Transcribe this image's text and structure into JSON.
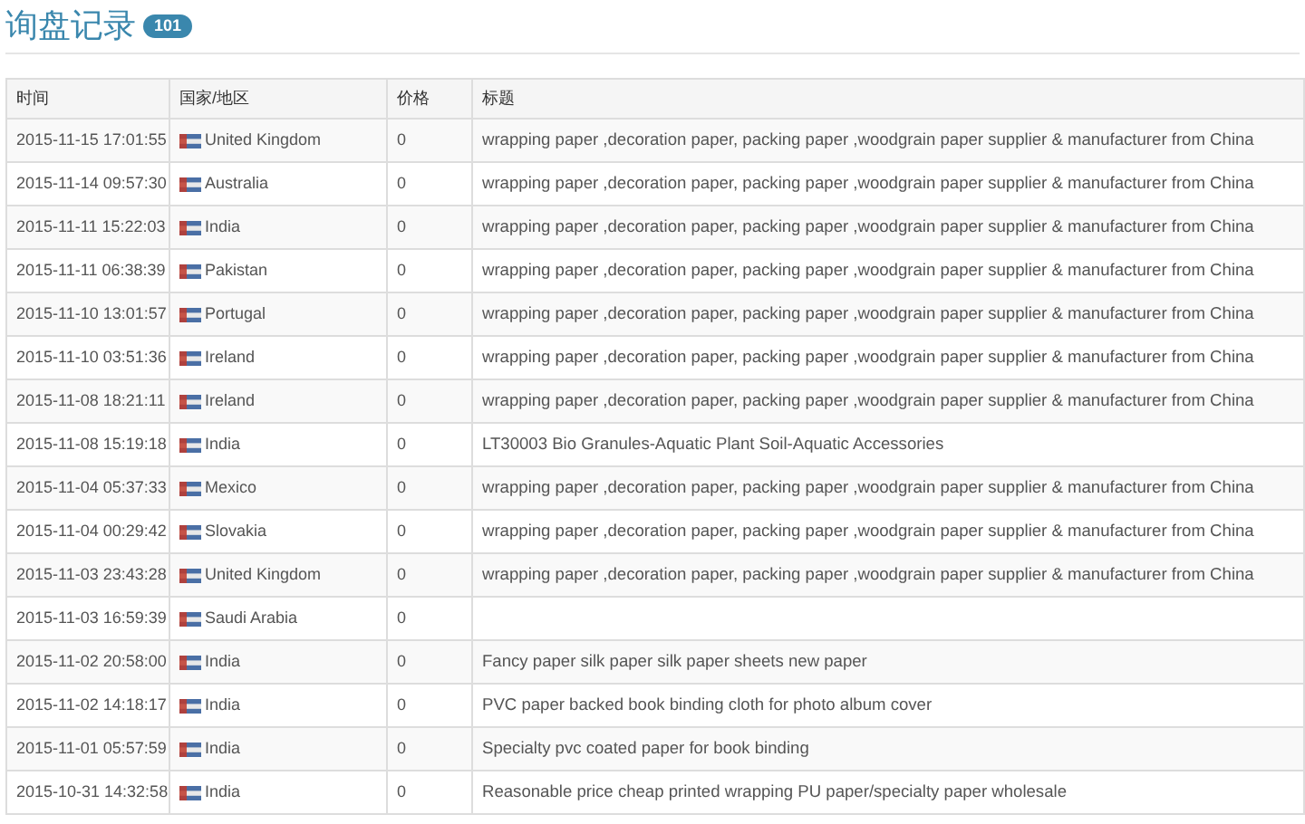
{
  "title": "询盘记录",
  "count": "101",
  "table": {
    "columns": [
      "时间",
      "国家/地区",
      "价格",
      "标题"
    ],
    "rows": [
      {
        "time": "2015-11-15 17:01:55",
        "country": "United Kingdom",
        "price": "0",
        "title": "wrapping paper ,decoration paper, packing paper ,woodgrain paper supplier & manufacturer from China"
      },
      {
        "time": "2015-11-14 09:57:30",
        "country": "Australia",
        "price": "0",
        "title": "wrapping paper ,decoration paper, packing paper ,woodgrain paper supplier & manufacturer from China"
      },
      {
        "time": "2015-11-11 15:22:03",
        "country": "India",
        "price": "0",
        "title": "wrapping paper ,decoration paper, packing paper ,woodgrain paper supplier & manufacturer from China"
      },
      {
        "time": "2015-11-11 06:38:39",
        "country": "Pakistan",
        "price": "0",
        "title": "wrapping paper ,decoration paper, packing paper ,woodgrain paper supplier & manufacturer from China"
      },
      {
        "time": "2015-11-10 13:01:57",
        "country": "Portugal",
        "price": "0",
        "title": "wrapping paper ,decoration paper, packing paper ,woodgrain paper supplier & manufacturer from China"
      },
      {
        "time": "2015-11-10 03:51:36",
        "country": "Ireland",
        "price": "0",
        "title": "wrapping paper ,decoration paper, packing paper ,woodgrain paper supplier & manufacturer from China"
      },
      {
        "time": "2015-11-08 18:21:11",
        "country": "Ireland",
        "price": "0",
        "title": "wrapping paper ,decoration paper, packing paper ,woodgrain paper supplier & manufacturer from China"
      },
      {
        "time": "2015-11-08 15:19:18",
        "country": "India",
        "price": "0",
        "title": "LT30003 Bio Granules-Aquatic Plant Soil-Aquatic Accessories"
      },
      {
        "time": "2015-11-04 05:37:33",
        "country": "Mexico",
        "price": "0",
        "title": "wrapping paper ,decoration paper, packing paper ,woodgrain paper supplier & manufacturer from China"
      },
      {
        "time": "2015-11-04 00:29:42",
        "country": "Slovakia",
        "price": "0",
        "title": "wrapping paper ,decoration paper, packing paper ,woodgrain paper supplier & manufacturer from China"
      },
      {
        "time": "2015-11-03 23:43:28",
        "country": "United Kingdom",
        "price": "0",
        "title": "wrapping paper ,decoration paper, packing paper ,woodgrain paper supplier & manufacturer from China"
      },
      {
        "time": "2015-11-03 16:59:39",
        "country": "Saudi Arabia",
        "price": "0"
      },
      {
        "time": "2015-11-02 20:58:00",
        "country": "India",
        "price": "0",
        "title": "Fancy paper silk paper silk paper sheets new paper"
      },
      {
        "time": "2015-11-02 14:18:17",
        "country": "India",
        "price": "0",
        "title": "PVC paper backed book binding cloth for photo album cover"
      },
      {
        "time": "2015-11-01 05:57:59",
        "country": "India",
        "price": "0",
        "title": "Specialty pvc coated paper for book binding"
      },
      {
        "time": "2015-10-31 14:32:58",
        "country": "India",
        "price": "0",
        "title": "Reasonable price cheap printed wrapping PU paper/specialty paper wholesale"
      }
    ]
  }
}
